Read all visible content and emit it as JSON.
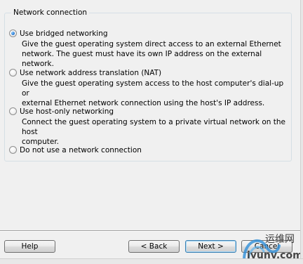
{
  "network": {
    "legend": "Network connection",
    "options": [
      {
        "label": "Use bridged networking",
        "desc": "Give the guest operating system direct access to an external Ethernet\nnetwork. The guest must have its own IP address on the external network.",
        "checked": true
      },
      {
        "label": "Use network address translation (NAT)",
        "desc": "Give the guest operating system access to the host computer's dial-up or\nexternal Ethernet network connection using the host's IP address.",
        "checked": false
      },
      {
        "label": "Use host-only networking",
        "desc": "Connect the guest operating system to a private virtual network on the host\ncomputer.",
        "checked": false
      },
      {
        "label": "Do not use a network connection",
        "desc": "",
        "checked": false
      }
    ]
  },
  "buttons": {
    "help": "Help",
    "back": "< Back",
    "next": "Next >",
    "cancel": "Cancel"
  },
  "watermark": {
    "title": "运维网",
    "url": "iyunv.com"
  }
}
